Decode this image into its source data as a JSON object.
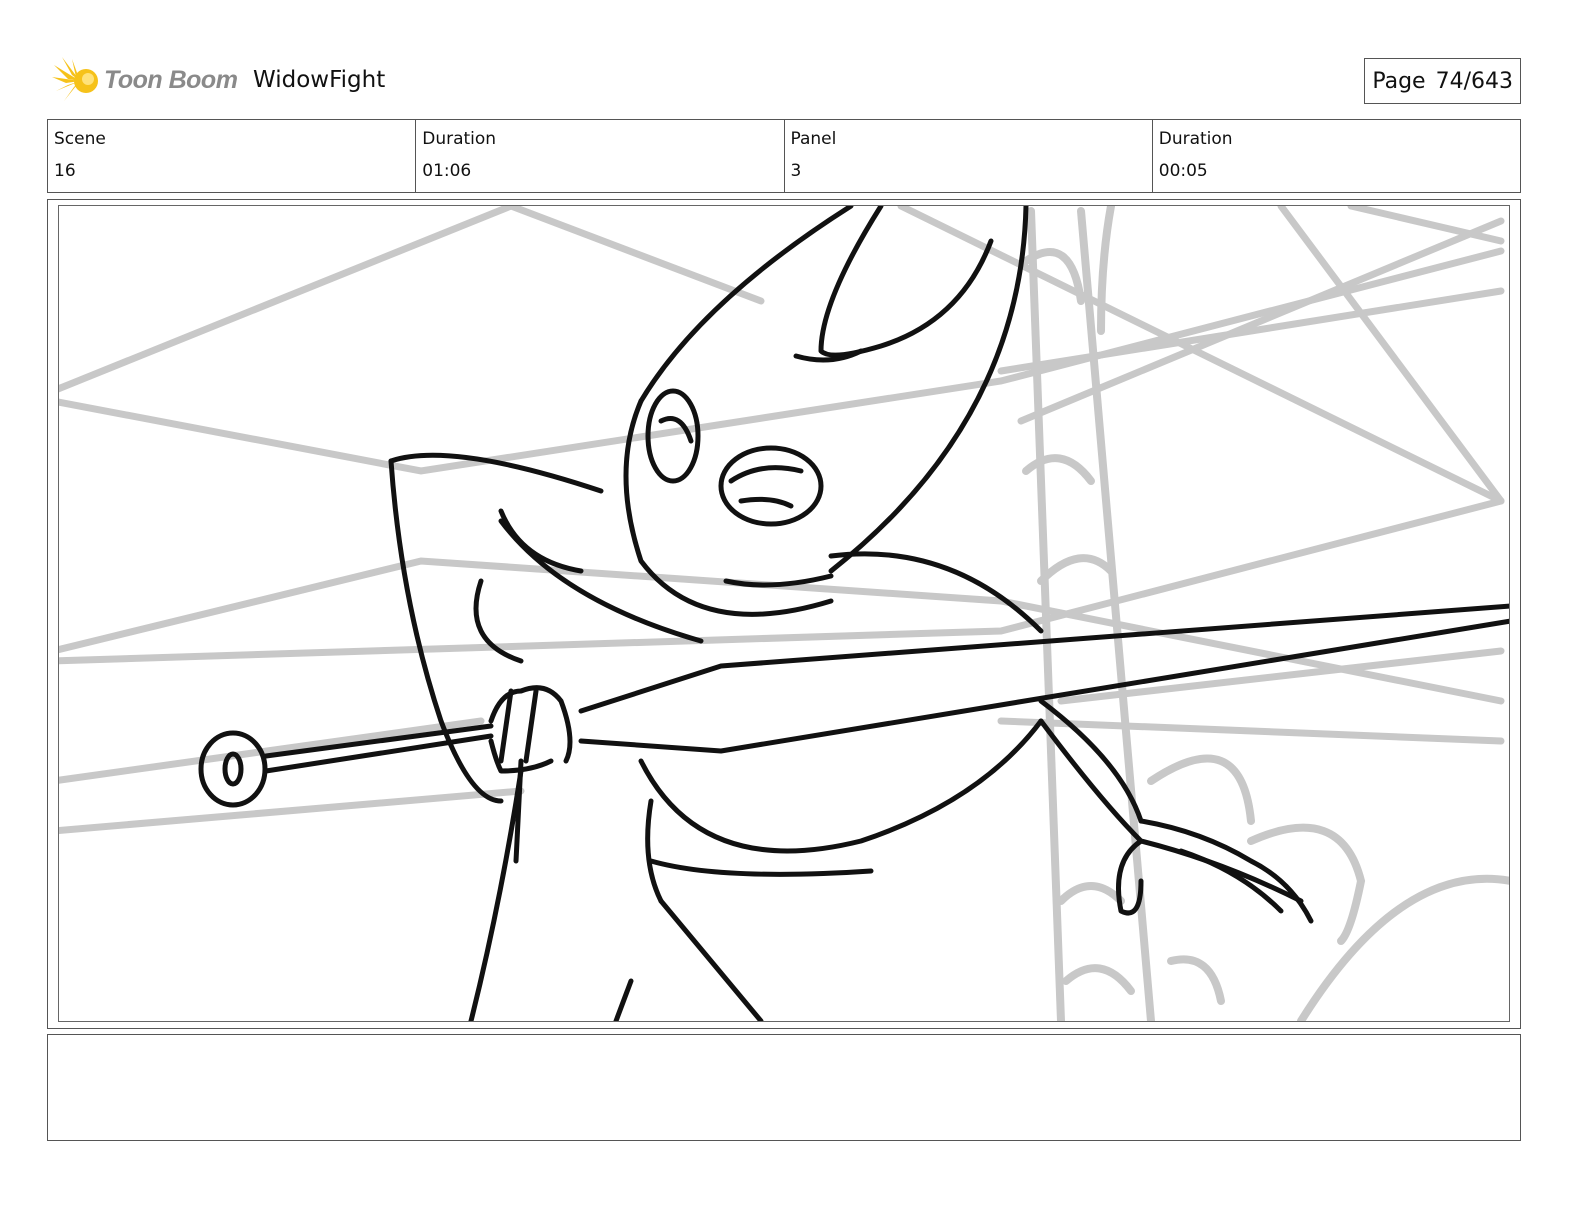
{
  "header": {
    "brand": "Toon Boom",
    "project_title": "WidowFight",
    "page_label": "Page",
    "page_number": "74/643"
  },
  "info": {
    "scene_label": "Scene",
    "scene_value": "16",
    "scene_duration_label": "Duration",
    "scene_duration_value": "01:06",
    "panel_label": "Panel",
    "panel_value": "3",
    "panel_duration_label": "Duration",
    "panel_duration_value": "00:05"
  },
  "notes": {
    "text": ""
  },
  "colors": {
    "logo_star": "#f6c21a",
    "logo_text": "#8a8a8a",
    "sketch_ink": "#111111",
    "background_sketch": "#c8c8c8",
    "border": "#555555"
  }
}
